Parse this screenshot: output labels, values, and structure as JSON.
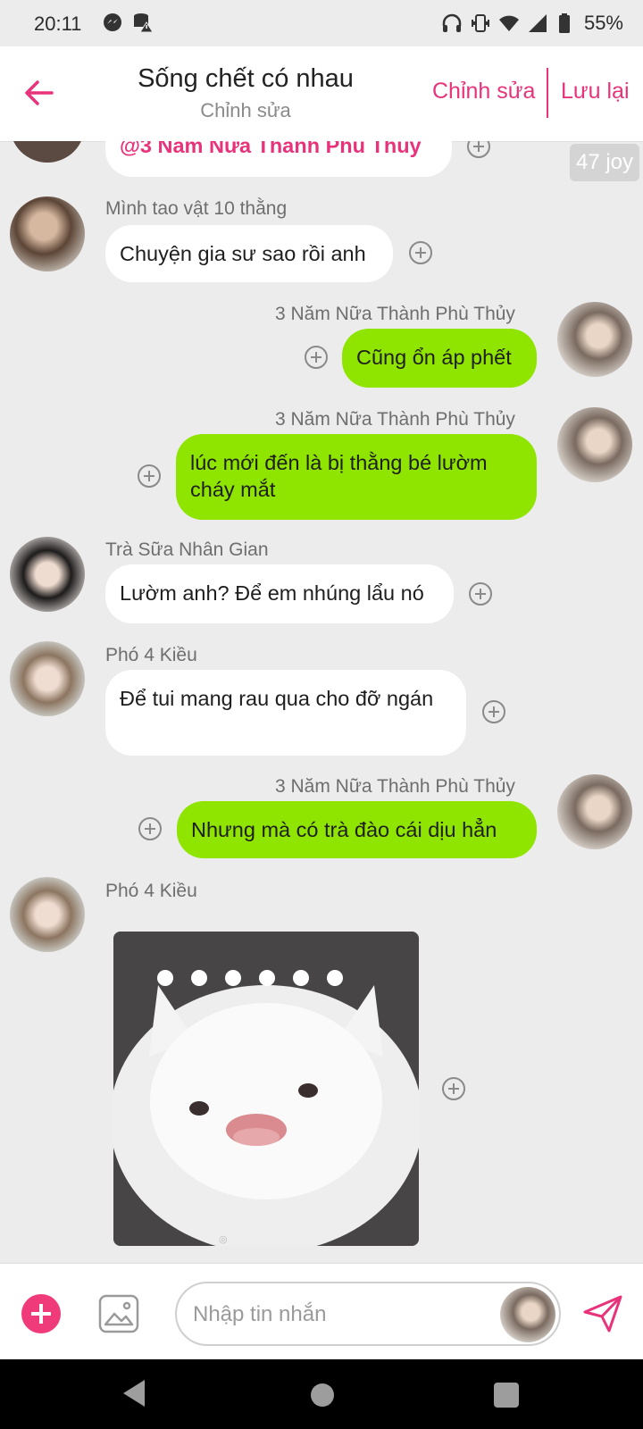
{
  "status_bar": {
    "time": "20:11",
    "battery": "55%",
    "icons": [
      "messenger-icon",
      "database-warning-icon",
      "headphones-icon",
      "vibrate-icon",
      "wifi-icon",
      "signal-icon",
      "battery-icon"
    ]
  },
  "header": {
    "title": "Sống chết có nhau",
    "subtitle": "Chỉnh sửa",
    "edit_label": "Chỉnh sửa",
    "save_label": "Lưu lại",
    "accent_color": "#e8337a"
  },
  "chat": {
    "top_partial": {
      "mention": "@3 Năm Nữa Thành Phù Thủy",
      "badge": "47 joy"
    },
    "messages": [
      {
        "sender": "Mình tao vật 10 thằng",
        "text": "Chuyện gia sư sao rồi anh",
        "direction": "in"
      },
      {
        "sender": "3 Năm Nữa Thành Phù Thủy",
        "text": "Cũng ổn áp phết",
        "direction": "out"
      },
      {
        "sender": "3 Năm Nữa Thành Phù Thủy",
        "text": "lúc mới đến là bị thằng bé lườm cháy mắt",
        "direction": "out"
      },
      {
        "sender": "Trà Sữa Nhân Gian",
        "text": "Lườm anh? Để em nhúng lẩu nó",
        "direction": "in"
      },
      {
        "sender": "Phó 4 Kiều",
        "text": "Để tui mang rau qua cho đỡ ngán",
        "direction": "in"
      },
      {
        "sender": "3 Năm Nữa Thành Phù Thủy",
        "text": "Nhưng mà có trà đào cái dịu hẳn",
        "direction": "out"
      },
      {
        "sender": "Phó 4 Kiều",
        "text": "",
        "direction": "in",
        "attachment": "cat-photo"
      }
    ],
    "bubble_out_color": "#8fe400",
    "bubble_in_color": "#ffffff"
  },
  "input": {
    "placeholder": "Nhập tin nhắn"
  }
}
